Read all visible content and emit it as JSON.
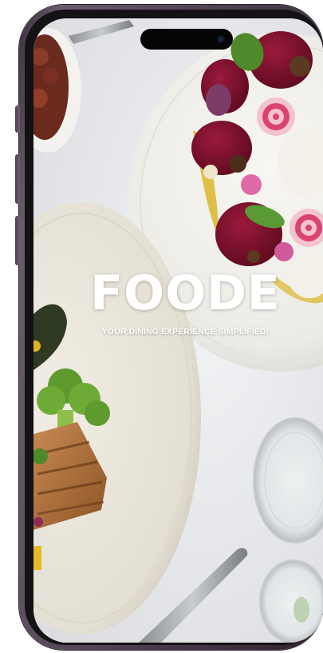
{
  "app": {
    "name": "FOODE",
    "tagline": "YOUR DINING EXPERIENCE SIMPLIFIED!"
  },
  "colors": {
    "frame": "#4a3d4c",
    "brand_text": "#ffffff",
    "tablecloth": "#e9eaec",
    "beet": "#7a0f2a"
  },
  "screen": {
    "background_image": "food-table-photo"
  }
}
